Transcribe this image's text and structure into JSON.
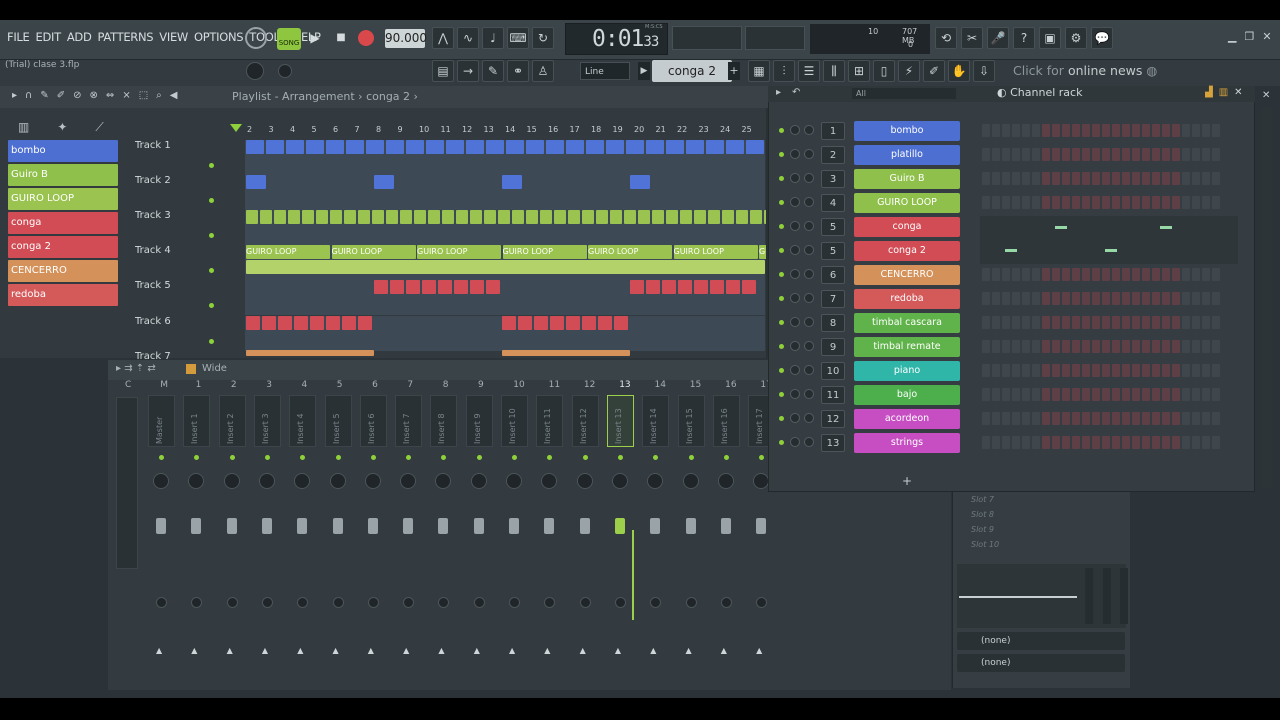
{
  "menu": [
    "FILE",
    "EDIT",
    "ADD",
    "PATTERNS",
    "VIEW",
    "OPTIONS",
    "TOOLS",
    "HELP"
  ],
  "file_hint": "(Trial) clase 3.flp",
  "transport": {
    "mode": "SONG",
    "tempo": "90.000",
    "time": "0:01",
    "time_small": "33",
    "time_unit": "M:S:CS",
    "cpu": "10",
    "mem": "707 MB",
    "voices": "0"
  },
  "snap": "Line",
  "pattern": "conga 2",
  "news": {
    "prefix": "Click for",
    "text": "online news"
  },
  "playlist": {
    "title": "Playlist - Arrangement",
    "pattern": "conga 2",
    "ruler": [
      "2",
      "3",
      "4",
      "5",
      "6",
      "7",
      "8",
      "9",
      "10",
      "11",
      "12",
      "13",
      "14",
      "15",
      "16",
      "17",
      "18",
      "19",
      "20",
      "21",
      "22",
      "23",
      "24",
      "25"
    ],
    "browser": [
      {
        "name": "bombo",
        "color": "#4d6fd2"
      },
      {
        "name": "Guiro B",
        "color": "#8fc04c"
      },
      {
        "name": "GUIRO LOOP",
        "color": "#9bc34f"
      },
      {
        "name": "conga",
        "color": "#d24c55"
      },
      {
        "name": "conga 2",
        "color": "#d24c55"
      },
      {
        "name": "CENCERRO",
        "color": "#d4925a"
      },
      {
        "name": "redoba",
        "color": "#d45a5a"
      }
    ],
    "tracks": [
      "Track 1",
      "Track 2",
      "Track 3",
      "Track 4",
      "Track 5",
      "Track 6",
      "Track 7"
    ],
    "clip_loop": "GUIRO LOOP"
  },
  "mixer": {
    "preset": "Wide",
    "cols": [
      "C",
      "M",
      "1",
      "2",
      "3",
      "4",
      "5",
      "6",
      "7",
      "8",
      "9",
      "10",
      "11",
      "12",
      "13",
      "14",
      "15",
      "16",
      "17"
    ],
    "inserts": [
      "Master",
      "Insert 1",
      "Insert 2",
      "Insert 3",
      "Insert 4",
      "Insert 5",
      "Insert 6",
      "Insert 7",
      "Insert 8",
      "Insert 9",
      "Insert 10",
      "Insert 11",
      "Insert 12",
      "Insert 13",
      "Insert 14",
      "Insert 15",
      "Insert 16",
      "Insert 17"
    ],
    "slots": [
      "Slot 7",
      "Slot 8",
      "Slot 9",
      "Slot 10"
    ],
    "routing": [
      "(none)",
      "(none)"
    ]
  },
  "channel_rack": {
    "title": "Channel rack",
    "filter": "All",
    "add": "+",
    "channels": [
      {
        "num": "1",
        "name": "bombo",
        "color": "#4d6fd2"
      },
      {
        "num": "2",
        "name": "platillo",
        "color": "#4d6fd2"
      },
      {
        "num": "3",
        "name": "Guiro B",
        "color": "#8fc04c"
      },
      {
        "num": "4",
        "name": "GUIRO LOOP",
        "color": "#8fc04c"
      },
      {
        "num": "5",
        "name": "conga",
        "color": "#d24c55"
      },
      {
        "num": "5",
        "name": "conga 2",
        "color": "#d24c55"
      },
      {
        "num": "6",
        "name": "CENCERRO",
        "color": "#d4925a"
      },
      {
        "num": "7",
        "name": "redoba",
        "color": "#d45a5a"
      },
      {
        "num": "8",
        "name": "timbal cascara",
        "color": "#5fb34a"
      },
      {
        "num": "9",
        "name": "timbal remate",
        "color": "#5fb34a"
      },
      {
        "num": "10",
        "name": "piano",
        "color": "#2fb6a8"
      },
      {
        "num": "11",
        "name": "bajo",
        "color": "#4caf4c"
      },
      {
        "num": "12",
        "name": "acordeon",
        "color": "#c64ec2"
      },
      {
        "num": "13",
        "name": "strings",
        "color": "#c64ec2"
      }
    ]
  }
}
